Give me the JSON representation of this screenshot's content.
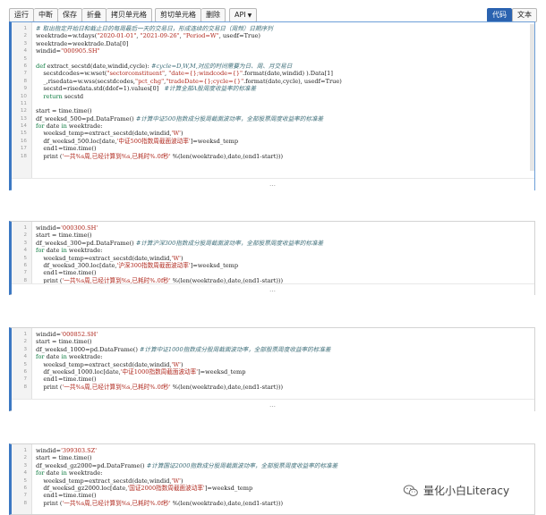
{
  "toolbar": {
    "buttons": [
      "运行",
      "中断",
      "保存",
      "折叠",
      "拷贝单元格",
      "剪切单元格",
      "删除",
      "API"
    ],
    "view_code": "代码",
    "view_text": "文本"
  },
  "output_dots": "…",
  "cells": [
    {
      "lines": [
        {
          "n": "1",
          "t": "# 取出指定开始日和截止日的每周最后一天的交易日，形成连续的交易日（周频）日期序列"
        },
        {
          "n": "2",
          "t": "weektrade=w.tdays(\"2020-01-01\", \"2021-09-26\", \"Period=W\", usedf=True)"
        },
        {
          "n": "3",
          "t": "weektrade=weektrade.Data[0]"
        },
        {
          "n": "4",
          "t": "windid=\"000905.SH\""
        },
        {
          "n": "5",
          "t": ""
        },
        {
          "n": "6",
          "t": "def extract_secstd(date,windid,cycle): #cycle=D,W,M,对应的时间需要为日、周、月交易日"
        },
        {
          "n": "7",
          "t": "    secstdcodes=w.wset(\"sectorconstituent\", \"date={};windcode={}\".format(date,windid) ).Data[1]"
        },
        {
          "n": "8",
          "t": "    _,risedata=w.wss(secstdcodes,\"pct_chg\",\"tradeDate={};cycle={}\".format(date,cycle), usedf=True)"
        },
        {
          "n": "9",
          "t": "    secstd=risedata.std(ddof=1).values[0]   #计算全部A股周度收益率的标准差"
        },
        {
          "n": "10",
          "t": "    return secstd"
        },
        {
          "n": "11",
          "t": ""
        },
        {
          "n": "12",
          "t": "start = time.time()"
        },
        {
          "n": "13",
          "t": "df_weeksd_500=pd.DataFrame() #计算中证500指数成分股周截面波动率，全部股票周度收益率的标准差"
        },
        {
          "n": "14",
          "t": "for date in weektrade:"
        },
        {
          "n": "15",
          "t": "    weeksd_temp=extract_secstd(date,windid,'W')"
        },
        {
          "n": "16",
          "t": "    df_weeksd_500.loc[date,'中证500指数周截面波动率']=weeksd_temp"
        },
        {
          "n": "17",
          "t": "    end1=time.time()"
        },
        {
          "n": "18",
          "t": "    print ('一共%s周,已经计算到%s,已耗时%.0f秒' %(len(weektrade),date,(end1-start)))"
        }
      ]
    },
    {
      "lines": [
        {
          "n": "1",
          "t": "windid='000300.SH'"
        },
        {
          "n": "2",
          "t": "start = time.time()"
        },
        {
          "n": "3",
          "t": "df_weeksd_300=pd.DataFrame() #计算沪深300指数成分股周截面波动率，全部股票周度收益率的标准差"
        },
        {
          "n": "4",
          "t": "for date in weektrade:"
        },
        {
          "n": "5",
          "t": "    weeksd_temp=extract_secstd(date,windid,'W')"
        },
        {
          "n": "6",
          "t": "    df_weeksd_300.loc[date,'沪深300指数周截面波动率']=weeksd_temp"
        },
        {
          "n": "7",
          "t": "    end1=time.time()"
        },
        {
          "n": "8",
          "t": "    print ('一共%s周,已经计算到%s,已耗时%.0f秒' %(len(weektrade),date,(end1-start)))"
        }
      ]
    },
    {
      "lines": [
        {
          "n": "1",
          "t": "windid='000852.SH'"
        },
        {
          "n": "2",
          "t": "start = time.time()"
        },
        {
          "n": "3",
          "t": "df_weeksd_1000=pd.DataFrame() #计算中证1000指数成分股周截面波动率，全部股票周度收益率的标准差"
        },
        {
          "n": "4",
          "t": "for date in weektrade:"
        },
        {
          "n": "5",
          "t": "    weeksd_temp=extract_secstd(date,windid,'W')"
        },
        {
          "n": "6",
          "t": "    df_weeksd_1000.loc[date,'中证1000指数周截面波动率']=weeksd_temp"
        },
        {
          "n": "7",
          "t": "    end1=time.time()"
        },
        {
          "n": "8",
          "t": "    print ('一共%s周,已经计算到%s,已耗时%.0f秒' %(len(weektrade),date,(end1-start)))"
        }
      ]
    },
    {
      "lines": [
        {
          "n": "1",
          "t": "windid='399303.SZ'"
        },
        {
          "n": "2",
          "t": "start = time.time()"
        },
        {
          "n": "3",
          "t": "df_weeksd_gz2000=pd.DataFrame() #计算国证2000指数成分股周截面波动率，全部股票周度收益率的标准差"
        },
        {
          "n": "4",
          "t": "for date in weektrade:"
        },
        {
          "n": "5",
          "t": "    weeksd_temp=extract_secstd(date,windid,'W')"
        },
        {
          "n": "6",
          "t": "    df_weeksd_gz2000.loc[date,'国证2000指数周截面波动率']=weeksd_temp"
        },
        {
          "n": "7",
          "t": "    end1=time.time()"
        },
        {
          "n": "8",
          "t": "    print ('一共%s周,已经计算到%s,已耗时%.0f秒' %(len(weektrade),date,(end1-start)))"
        }
      ]
    }
  ],
  "watermark": {
    "text": "量化小白Literacy",
    "icon": "wechat-icon"
  }
}
